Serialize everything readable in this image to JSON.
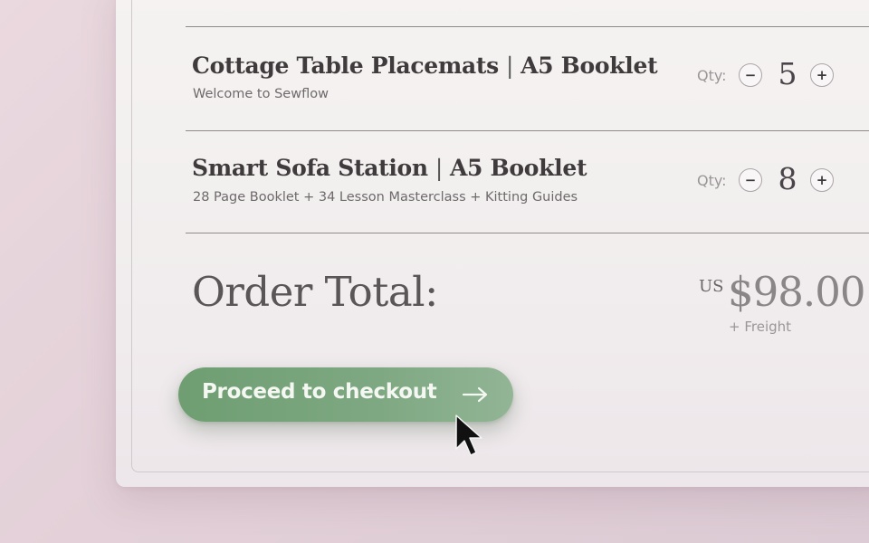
{
  "items": [
    {
      "name": "Cottage Table Placemats",
      "format": "A5 Booklet",
      "subtitle": "Welcome to Sewflow",
      "qty_label": "Qty:",
      "qty": "5"
    },
    {
      "name": "Smart Sofa Station",
      "format": "A5 Booklet",
      "subtitle": "28 Page Booklet + 34 Lesson Masterclass + Kitting Guides",
      "qty_label": "Qty:",
      "qty": "8"
    }
  ],
  "controls": {
    "decrease_symbol": "−",
    "increase_symbol": "+",
    "separator": "|"
  },
  "total": {
    "label": "Order Total:",
    "currency": "US",
    "amount": "$98.00",
    "note": "+ Freight"
  },
  "checkout": {
    "label": "Proceed to checkout",
    "icon": "arrow-right-icon"
  },
  "colors": {
    "button_green": "#7ea882",
    "background_pink": "#e3d0d8"
  }
}
